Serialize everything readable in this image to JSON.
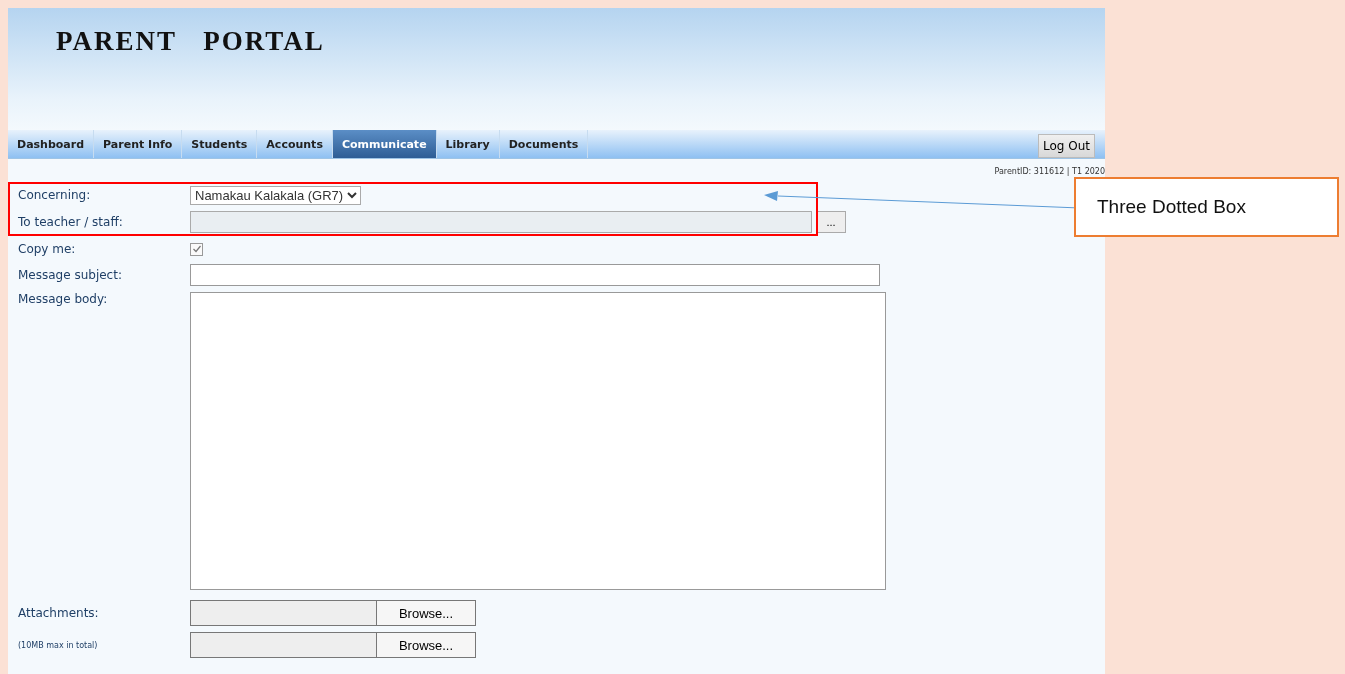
{
  "header": {
    "title": "PARENT PORTAL"
  },
  "nav": {
    "tabs": [
      {
        "label": "Dashboard",
        "selected": false
      },
      {
        "label": "Parent Info",
        "selected": false
      },
      {
        "label": "Students",
        "selected": false
      },
      {
        "label": "Accounts",
        "selected": false
      },
      {
        "label": "Communicate",
        "selected": true
      },
      {
        "label": "Library",
        "selected": false
      },
      {
        "label": "Documents",
        "selected": false
      }
    ],
    "logout": "Log Out",
    "status": "ParentID: 311612 | T1 2020"
  },
  "form": {
    "concerning": {
      "label": "Concerning:",
      "value": "Namakau Kalakala (GR7)"
    },
    "to_staff": {
      "label": "To teacher / staff:",
      "lookup_button": "..."
    },
    "copy_me": {
      "label": "Copy me:",
      "checked": true
    },
    "subject": {
      "label": "Message subject:"
    },
    "body": {
      "label": "Message body:"
    },
    "attachments": {
      "label": "Attachments:",
      "note": "(10MB max in total)",
      "browse": [
        "Browse...",
        "Browse..."
      ]
    }
  },
  "annotation": {
    "callout": "Three Dotted Box"
  }
}
